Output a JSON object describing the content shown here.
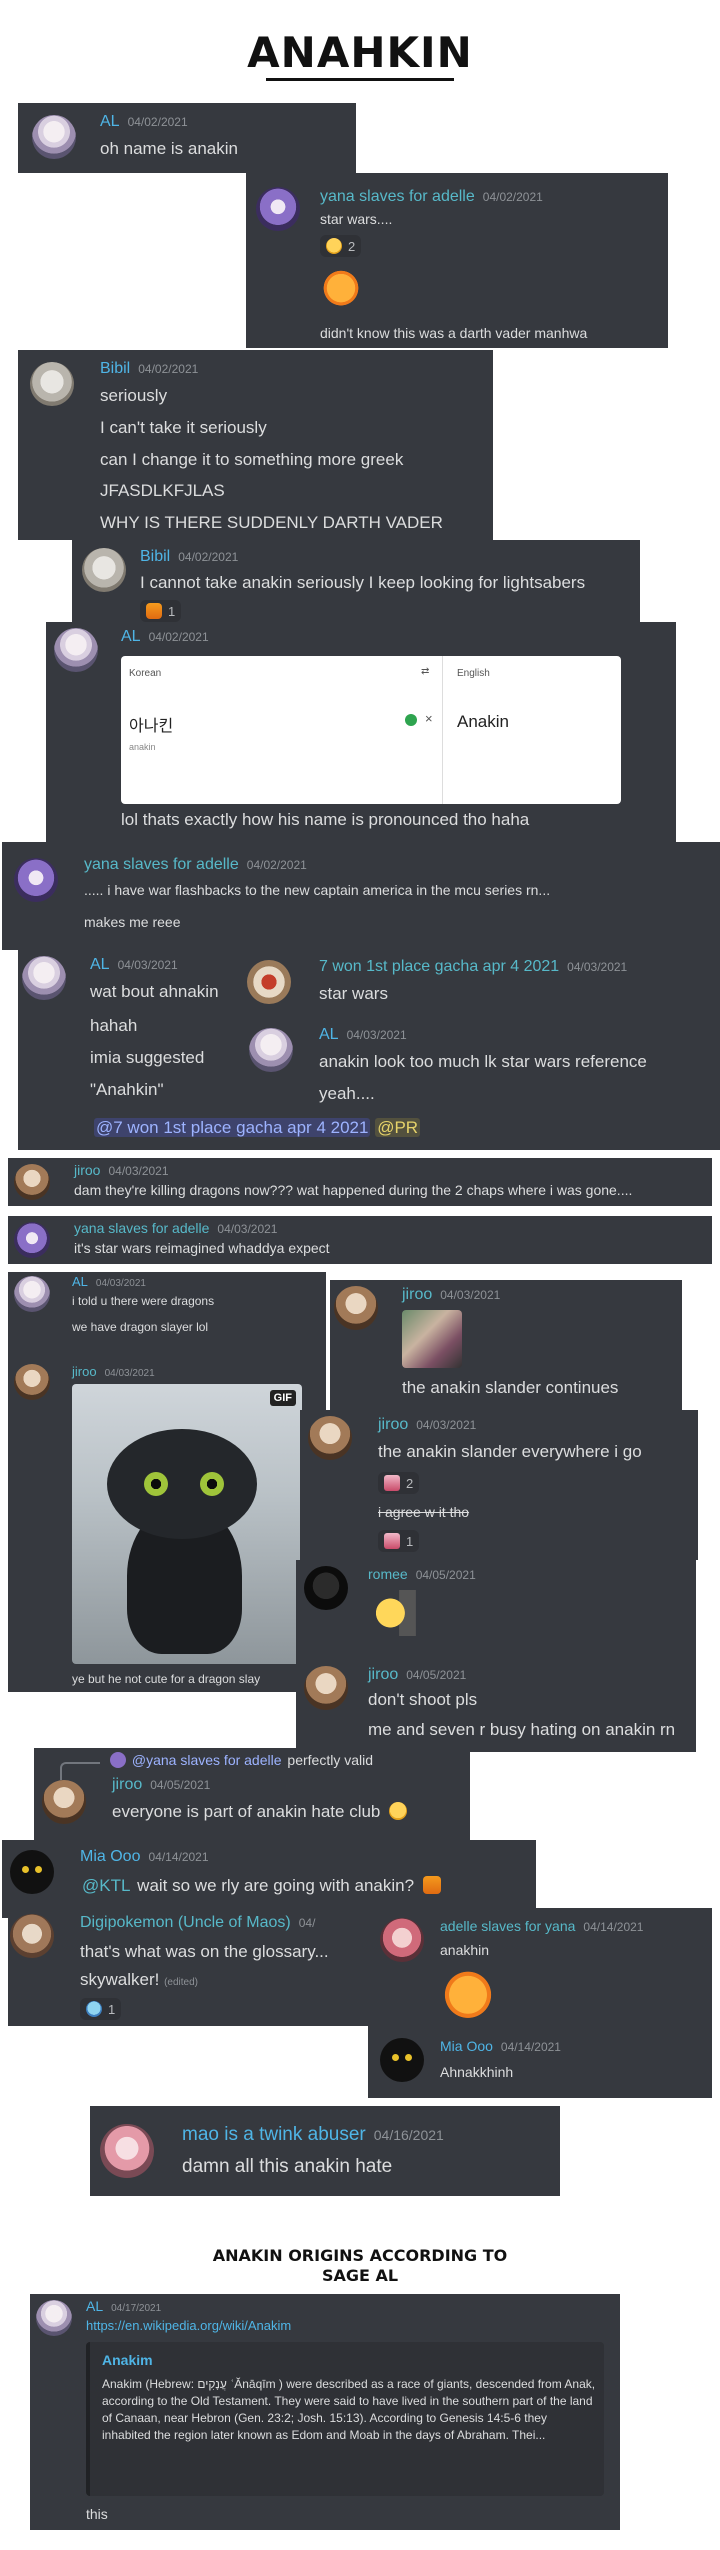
{
  "page": {
    "title": "ANAHKIN"
  },
  "m1": {
    "name": "AL",
    "time": "04/02/2021",
    "text": "oh      name is anakin"
  },
  "m2": {
    "name": "yana slaves for adelle",
    "time": "04/02/2021",
    "text1": "star wars....",
    "reaction_count": "2",
    "text2": "didn't know this was a darth vader manhwa"
  },
  "m3": {
    "name": "Bibil",
    "time": "04/02/2021",
    "lines": [
      "seriously",
      "I can't take it seriously",
      "can I change it to something more greek",
      "JFASDLKFJLAS",
      "WHY IS THERE SUDDENLY DARTH VADER"
    ]
  },
  "m4": {
    "name": "Bibil",
    "time": "04/02/2021",
    "text": "I cannot take anakin seriously I keep looking for lightsabers",
    "reaction_count": "1"
  },
  "m5": {
    "name": "AL",
    "time": "04/02/2021",
    "translator": {
      "src_lang": "Korean",
      "dst_lang": "English",
      "src_word": "아나킨",
      "romanization": "anakin",
      "dst_word": "Anakin"
    },
    "text": "lol thats exactly how his name is pronounced tho haha"
  },
  "m6": {
    "name": "yana slaves for adelle",
    "time": "04/02/2021",
    "text1": "..... i have war flashbacks to the new captain america in the mcu series rn...",
    "text2": "makes me reee"
  },
  "m7": {
    "name": "AL",
    "time": "04/03/2021",
    "lines": [
      "wat bout ahnakin",
      "hahah",
      "imia suggested",
      "\"Anahkin\""
    ]
  },
  "m8": {
    "name": "7 won 1st place gacha apr 4 2021",
    "time": "04/03/2021",
    "text": "star wars"
  },
  "m9": {
    "name": "AL",
    "time": "04/03/2021",
    "text1": "anakin look too much lk star wars reference",
    "text2": "yeah...."
  },
  "mentions_line": {
    "mention1": "@7 won 1st place gacha apr 4 2021",
    "mention2": "@PR"
  },
  "m10": {
    "name": "jiroo",
    "time": "04/03/2021",
    "text": "dam they're killing dragons now??? wat happened during the 2 chaps where i was gone...."
  },
  "m11": {
    "name": "yana slaves for adelle",
    "time": "04/03/2021",
    "text": "it's star wars reimagined whaddya expect"
  },
  "m12": {
    "name": "AL",
    "time": "04/03/2021",
    "text1": "i told u there were dragons",
    "text2": "we have dragon slayer lol"
  },
  "m13": {
    "name": "jiroo",
    "time": "04/03/2021",
    "gif_label": "GIF",
    "text": "ye but he not cute for a dragon slay"
  },
  "m14": {
    "name": "jiroo",
    "time": "04/03/2021",
    "text": "the anakin slander continues"
  },
  "m15": {
    "name": "jiroo",
    "time": "04/03/2021",
    "text1": "the anakin slander everywhere i go",
    "reaction1_count": "2",
    "text2": "i agree w it tho",
    "reaction2_count": "1"
  },
  "m16": {
    "name": "romee",
    "time": "04/05/2021"
  },
  "m17": {
    "name": "jiroo",
    "time": "04/05/2021",
    "text1": "don't shoot pls",
    "text2": "me and seven r busy hating on anakin rn"
  },
  "m18": {
    "reply_mention": "@yana slaves for adelle",
    "reply_text": "perfectly valid",
    "name": "jiroo",
    "time": "04/05/2021",
    "text": "everyone is part of anakin hate club"
  },
  "m19": {
    "name": "Mia Ooo",
    "time": "04/14/2021",
    "mention": "@KTL",
    "text": "wait so we rly are going with anakin?"
  },
  "m20": {
    "name": "Digipokemon (Uncle of Maos)",
    "time": "04/",
    "text1": "that's what was on the glossary...",
    "text2": "skywalker!",
    "edited": "(edited)",
    "reaction_count": "1"
  },
  "m21": {
    "name": "adelle slaves for yana",
    "time": "04/14/2021",
    "text": "anakhin"
  },
  "m22": {
    "name": "Mia Ooo",
    "time": "04/14/2021",
    "text": "Ahnakkhinh"
  },
  "m23": {
    "name": "mao is a twink abuser",
    "time": "04/16/2021",
    "text": "damn all this anakin hate"
  },
  "origins": {
    "line1": "ANAKIN ORIGINS ACCORDING TO",
    "line2": "SAGE AL"
  },
  "m24": {
    "name": "AL",
    "time": "04/17/2021",
    "link": "https://en.wikipedia.org/wiki/Anakim",
    "embed_title": "Anakim",
    "embed_desc": "Anakim (Hebrew: עֲנָקִים ʿĂnāqīm ) were described as a race of giants, descended from Anak, according to the Old Testament. They were said to have lived in the southern part of the land of Canaan, near Hebron (Gen. 23:2; Josh. 15:13). According to Genesis 14:5-6 they inhabited the region later known as Edom and Moab in the days of Abraham. Thei...",
    "text": "this"
  }
}
